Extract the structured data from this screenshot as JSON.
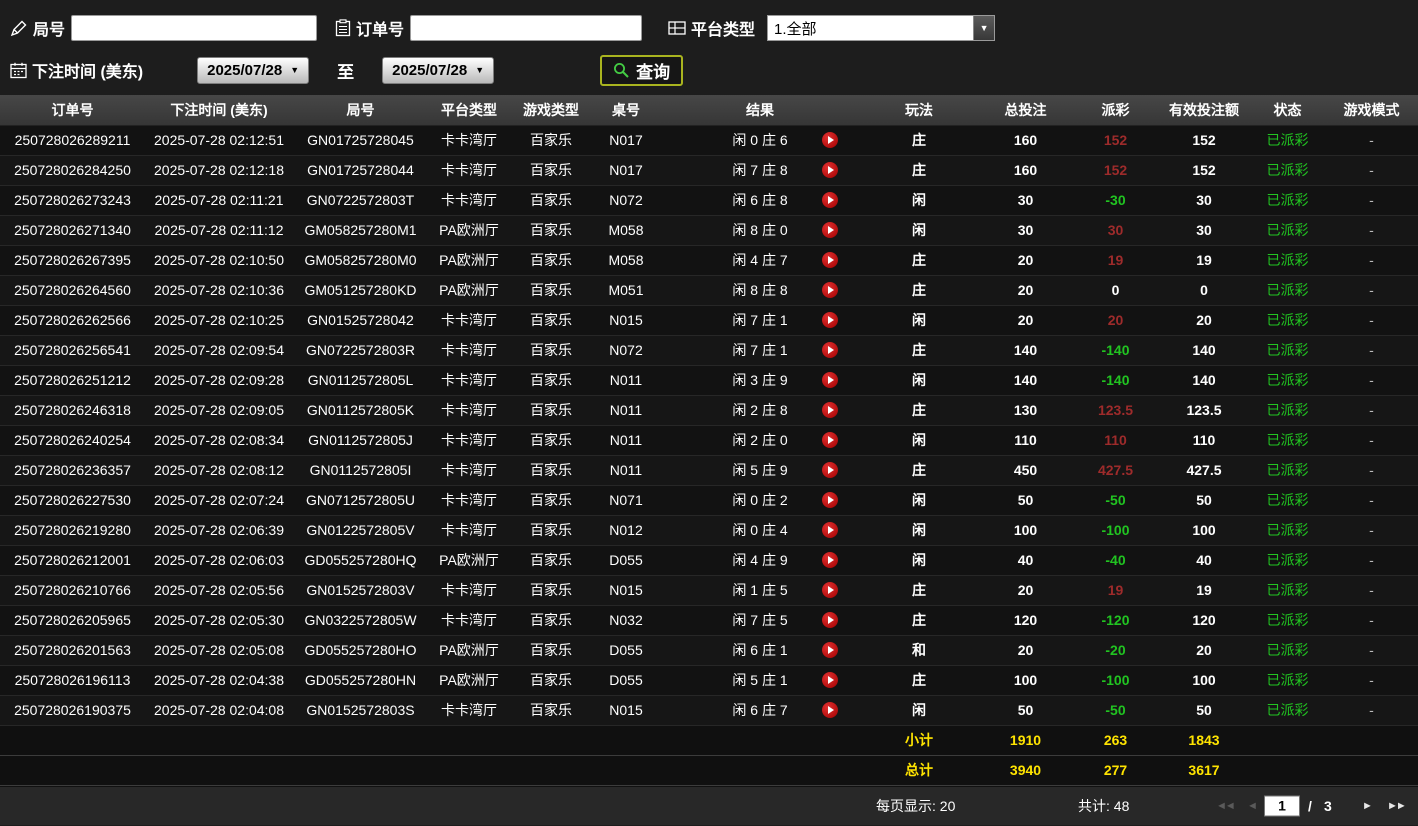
{
  "filters": {
    "round_label": "局号",
    "order_label": "订单号",
    "platform_label": "平台类型",
    "platform_value": "1.全部",
    "bet_time_label": "下注时间 (美东)",
    "date_from": "2025/07/28",
    "date_to": "2025/07/28",
    "to_label": "至",
    "query_label": "查询"
  },
  "icons": {
    "dropdown_caret": "▼",
    "first_page": "◄◄",
    "prev_page": "◄",
    "next_page": "►",
    "last_page": "►►"
  },
  "colors": {
    "payout_positive": "#9e2b2b",
    "payout_negative": "#21c421",
    "status_paid": "#21c421",
    "summary_value": "#ffe400",
    "query_button_border": "#a9b41f",
    "replay_button": "#cc1111"
  },
  "table": {
    "headers": [
      "订单号",
      "下注时间 (美东)",
      "局号",
      "平台类型",
      "游戏类型",
      "桌号",
      "结果",
      "玩法",
      "总投注",
      "派彩",
      "有效投注额",
      "状态",
      "游戏模式"
    ],
    "rows": [
      {
        "order": "250728026289211",
        "time": "2025-07-28 02:12:51",
        "round": "GN01725728045",
        "platform": "卡卡湾厅",
        "game": "百家乐",
        "table_no": "N017",
        "result": "闲 0 庄 6",
        "play": "庄",
        "total": "160",
        "payout": "152",
        "valid": "152",
        "status": "已派彩",
        "mode": "-"
      },
      {
        "order": "250728026284250",
        "time": "2025-07-28 02:12:18",
        "round": "GN01725728044",
        "platform": "卡卡湾厅",
        "game": "百家乐",
        "table_no": "N017",
        "result": "闲 7 庄 8",
        "play": "庄",
        "total": "160",
        "payout": "152",
        "valid": "152",
        "status": "已派彩",
        "mode": "-"
      },
      {
        "order": "250728026273243",
        "time": "2025-07-28 02:11:21",
        "round": "GN0722572803T",
        "platform": "卡卡湾厅",
        "game": "百家乐",
        "table_no": "N072",
        "result": "闲 6 庄 8",
        "play": "闲",
        "total": "30",
        "payout": "-30",
        "valid": "30",
        "status": "已派彩",
        "mode": "-"
      },
      {
        "order": "250728026271340",
        "time": "2025-07-28 02:11:12",
        "round": "GM058257280M1",
        "platform": "PA欧洲厅",
        "game": "百家乐",
        "table_no": "M058",
        "result": "闲 8 庄 0",
        "play": "闲",
        "total": "30",
        "payout": "30",
        "valid": "30",
        "status": "已派彩",
        "mode": "-"
      },
      {
        "order": "250728026267395",
        "time": "2025-07-28 02:10:50",
        "round": "GM058257280M0",
        "platform": "PA欧洲厅",
        "game": "百家乐",
        "table_no": "M058",
        "result": "闲 4 庄 7",
        "play": "庄",
        "total": "20",
        "payout": "19",
        "valid": "19",
        "status": "已派彩",
        "mode": "-"
      },
      {
        "order": "250728026264560",
        "time": "2025-07-28 02:10:36",
        "round": "GM051257280KD",
        "platform": "PA欧洲厅",
        "game": "百家乐",
        "table_no": "M051",
        "result": "闲 8 庄 8",
        "play": "庄",
        "total": "20",
        "payout": "0",
        "valid": "0",
        "status": "已派彩",
        "mode": "-"
      },
      {
        "order": "250728026262566",
        "time": "2025-07-28 02:10:25",
        "round": "GN01525728042",
        "platform": "卡卡湾厅",
        "game": "百家乐",
        "table_no": "N015",
        "result": "闲 7 庄 1",
        "play": "闲",
        "total": "20",
        "payout": "20",
        "valid": "20",
        "status": "已派彩",
        "mode": "-"
      },
      {
        "order": "250728026256541",
        "time": "2025-07-28 02:09:54",
        "round": "GN0722572803R",
        "platform": "卡卡湾厅",
        "game": "百家乐",
        "table_no": "N072",
        "result": "闲 7 庄 1",
        "play": "庄",
        "total": "140",
        "payout": "-140",
        "valid": "140",
        "status": "已派彩",
        "mode": "-"
      },
      {
        "order": "250728026251212",
        "time": "2025-07-28 02:09:28",
        "round": "GN0112572805L",
        "platform": "卡卡湾厅",
        "game": "百家乐",
        "table_no": "N011",
        "result": "闲 3 庄 9",
        "play": "闲",
        "total": "140",
        "payout": "-140",
        "valid": "140",
        "status": "已派彩",
        "mode": "-"
      },
      {
        "order": "250728026246318",
        "time": "2025-07-28 02:09:05",
        "round": "GN0112572805K",
        "platform": "卡卡湾厅",
        "game": "百家乐",
        "table_no": "N011",
        "result": "闲 2 庄 8",
        "play": "庄",
        "total": "130",
        "payout": "123.5",
        "valid": "123.5",
        "status": "已派彩",
        "mode": "-"
      },
      {
        "order": "250728026240254",
        "time": "2025-07-28 02:08:34",
        "round": "GN0112572805J",
        "platform": "卡卡湾厅",
        "game": "百家乐",
        "table_no": "N011",
        "result": "闲 2 庄 0",
        "play": "闲",
        "total": "110",
        "payout": "110",
        "valid": "110",
        "status": "已派彩",
        "mode": "-"
      },
      {
        "order": "250728026236357",
        "time": "2025-07-28 02:08:12",
        "round": "GN0112572805I",
        "platform": "卡卡湾厅",
        "game": "百家乐",
        "table_no": "N011",
        "result": "闲 5 庄 9",
        "play": "庄",
        "total": "450",
        "payout": "427.5",
        "valid": "427.5",
        "status": "已派彩",
        "mode": "-"
      },
      {
        "order": "250728026227530",
        "time": "2025-07-28 02:07:24",
        "round": "GN0712572805U",
        "platform": "卡卡湾厅",
        "game": "百家乐",
        "table_no": "N071",
        "result": "闲 0 庄 2",
        "play": "闲",
        "total": "50",
        "payout": "-50",
        "valid": "50",
        "status": "已派彩",
        "mode": "-"
      },
      {
        "order": "250728026219280",
        "time": "2025-07-28 02:06:39",
        "round": "GN0122572805V",
        "platform": "卡卡湾厅",
        "game": "百家乐",
        "table_no": "N012",
        "result": "闲 0 庄 4",
        "play": "闲",
        "total": "100",
        "payout": "-100",
        "valid": "100",
        "status": "已派彩",
        "mode": "-"
      },
      {
        "order": "250728026212001",
        "time": "2025-07-28 02:06:03",
        "round": "GD055257280HQ",
        "platform": "PA欧洲厅",
        "game": "百家乐",
        "table_no": "D055",
        "result": "闲 4 庄 9",
        "play": "闲",
        "total": "40",
        "payout": "-40",
        "valid": "40",
        "status": "已派彩",
        "mode": "-"
      },
      {
        "order": "250728026210766",
        "time": "2025-07-28 02:05:56",
        "round": "GN0152572803V",
        "platform": "卡卡湾厅",
        "game": "百家乐",
        "table_no": "N015",
        "result": "闲 1 庄 5",
        "play": "庄",
        "total": "20",
        "payout": "19",
        "valid": "19",
        "status": "已派彩",
        "mode": "-"
      },
      {
        "order": "250728026205965",
        "time": "2025-07-28 02:05:30",
        "round": "GN0322572805W",
        "platform": "卡卡湾厅",
        "game": "百家乐",
        "table_no": "N032",
        "result": "闲 7 庄 5",
        "play": "庄",
        "total": "120",
        "payout": "-120",
        "valid": "120",
        "status": "已派彩",
        "mode": "-"
      },
      {
        "order": "250728026201563",
        "time": "2025-07-28 02:05:08",
        "round": "GD055257280HO",
        "platform": "PA欧洲厅",
        "game": "百家乐",
        "table_no": "D055",
        "result": "闲 6 庄 1",
        "play": "和",
        "total": "20",
        "payout": "-20",
        "valid": "20",
        "status": "已派彩",
        "mode": "-"
      },
      {
        "order": "250728026196113",
        "time": "2025-07-28 02:04:38",
        "round": "GD055257280HN",
        "platform": "PA欧洲厅",
        "game": "百家乐",
        "table_no": "D055",
        "result": "闲 5 庄 1",
        "play": "庄",
        "total": "100",
        "payout": "-100",
        "valid": "100",
        "status": "已派彩",
        "mode": "-"
      },
      {
        "order": "250728026190375",
        "time": "2025-07-28 02:04:08",
        "round": "GN0152572803S",
        "platform": "卡卡湾厅",
        "game": "百家乐",
        "table_no": "N015",
        "result": "闲 6 庄 7",
        "play": "闲",
        "total": "50",
        "payout": "-50",
        "valid": "50",
        "status": "已派彩",
        "mode": "-"
      }
    ],
    "subtotal": {
      "label": "小计",
      "total_bet": "1910",
      "payout": "263",
      "valid_bet": "1843"
    },
    "grand_total": {
      "label": "总计",
      "total_bet": "3940",
      "payout": "277",
      "valid_bet": "3617"
    }
  },
  "pagination": {
    "per_page_label": "每页显示:",
    "per_page": "20",
    "total_label": "共计:",
    "total_count": "48",
    "current_page": "1",
    "page_separator": "/",
    "page_count": "3"
  }
}
